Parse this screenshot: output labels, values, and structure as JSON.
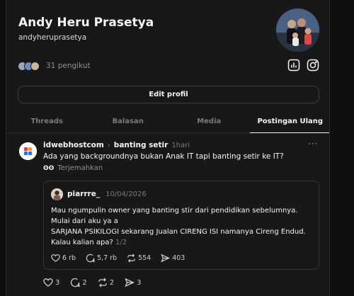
{
  "profile": {
    "name": "Andy Heru Prasetya",
    "handle": "andyheruprasetya",
    "followers_text": "31 pengikut",
    "edit_label": "Edit profil"
  },
  "tabs": [
    {
      "label": "Threads",
      "active": false
    },
    {
      "label": "Balasan",
      "active": false
    },
    {
      "label": "Media",
      "active": false
    },
    {
      "label": "Postingan Ulang",
      "active": true
    }
  ],
  "post": {
    "username": "idwebhostcom",
    "topic": "banting setir",
    "time": "1hari",
    "more": "···",
    "text": "Ada yang backgroundnya bukan Anak IT tapi banting setir ke IT?",
    "translate_label": "Terjemahkan",
    "quote": {
      "username": "piarrre_",
      "date": "10/04/2026",
      "lines": [
        "Mau ngumpulin owner yang banting stir dari pendidikan sebelumnya.",
        "Mulai dari aku ya a",
        "SARJANA PSIKILOGI sekarang Jualan CIRENG ISI namanya Cireng Endud.",
        "Kalau kalian apa?"
      ],
      "page": "1/2",
      "likes": "6 rb",
      "replies": "5,7 rb",
      "reposts": "554",
      "shares": "403"
    },
    "likes": "3",
    "replies": "2",
    "reposts": "2",
    "shares": "3"
  },
  "colors": {
    "background": "#181818",
    "text": "#f3f5f7",
    "muted": "#7a7a7a",
    "border": "#353535"
  }
}
